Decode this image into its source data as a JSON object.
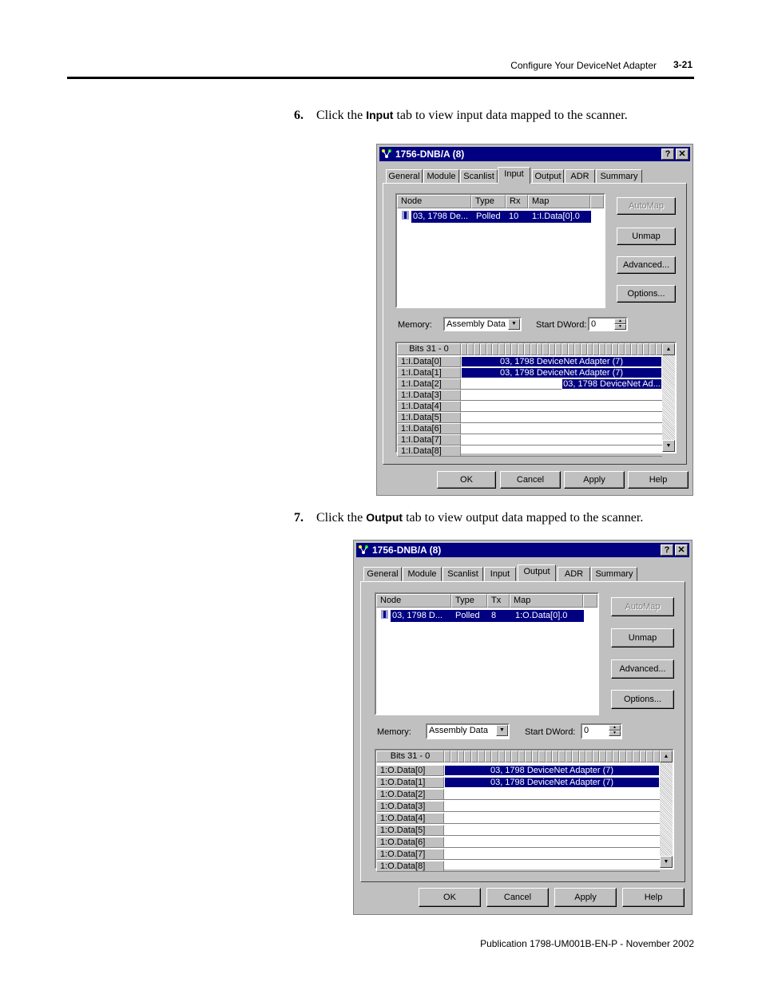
{
  "header": {
    "section_title": "Configure Your DeviceNet Adapter",
    "page_number": "3-21"
  },
  "steps": [
    {
      "number": "6.",
      "prefix": "Click the",
      "keyword": "Input",
      "suffix": "tab to view input data mapped to the scanner."
    },
    {
      "number": "7.",
      "prefix": "Click the",
      "keyword": "Output",
      "suffix": "tab to view output data mapped to the scanner."
    }
  ],
  "footer": {
    "publication": "Publication 1798-UM001B-EN-P - November 2002"
  },
  "dialog_input": {
    "title": "1756-DNB/A (8)",
    "tabs": [
      "General",
      "Module",
      "Scanlist",
      "Input",
      "Output",
      "ADR",
      "Summary"
    ],
    "active_tab": "Input",
    "columns": [
      "Node",
      "Type",
      "Rx",
      "Map"
    ],
    "row": {
      "node": "03, 1798 De...",
      "type": "Polled",
      "size": "10",
      "map": "1:I.Data[0].0"
    },
    "buttons": {
      "automap": "AutoMap",
      "unmap": "Unmap",
      "advanced": "Advanced...",
      "options": "Options..."
    },
    "memory_label": "Memory:",
    "memory_value": "Assembly Data",
    "start_dword_label": "Start DWord:",
    "start_dword_value": "0",
    "bits_header": "Bits 31 - 0",
    "grid_rows": [
      "1:I.Data[0]",
      "1:I.Data[1]",
      "1:I.Data[2]",
      "1:I.Data[3]",
      "1:I.Data[4]",
      "1:I.Data[5]",
      "1:I.Data[6]",
      "1:I.Data[7]",
      "1:I.Data[8]"
    ],
    "mapped_full": "03, 1798 DeviceNet Adapter (7)",
    "mapped_partial": "03, 1798 DeviceNet Ad...",
    "footer_buttons": {
      "ok": "OK",
      "cancel": "Cancel",
      "apply": "Apply",
      "help": "Help"
    }
  },
  "dialog_output": {
    "title": "1756-DNB/A (8)",
    "tabs": [
      "General",
      "Module",
      "Scanlist",
      "Input",
      "Output",
      "ADR",
      "Summary"
    ],
    "active_tab": "Output",
    "columns": [
      "Node",
      "Type",
      "Tx",
      "Map"
    ],
    "row": {
      "node": "03, 1798 D...",
      "type": "Polled",
      "size": "8",
      "map": "1:O.Data[0].0"
    },
    "buttons": {
      "automap": "AutoMap",
      "unmap": "Unmap",
      "advanced": "Advanced...",
      "options": "Options..."
    },
    "memory_label": "Memory:",
    "memory_value": "Assembly Data",
    "start_dword_label": "Start DWord:",
    "start_dword_value": "0",
    "bits_header": "Bits 31 - 0",
    "grid_rows": [
      "1:O.Data[0]",
      "1:O.Data[1]",
      "1:O.Data[2]",
      "1:O.Data[3]",
      "1:O.Data[4]",
      "1:O.Data[5]",
      "1:O.Data[6]",
      "1:O.Data[7]",
      "1:O.Data[8]"
    ],
    "mapped_full": "03, 1798 DeviceNet Adapter (7)",
    "footer_buttons": {
      "ok": "OK",
      "cancel": "Cancel",
      "apply": "Apply",
      "help": "Help"
    }
  },
  "colors": {
    "title_bar": "#000080",
    "dialog_face": "#c0c0c0",
    "selection": "#000080"
  }
}
